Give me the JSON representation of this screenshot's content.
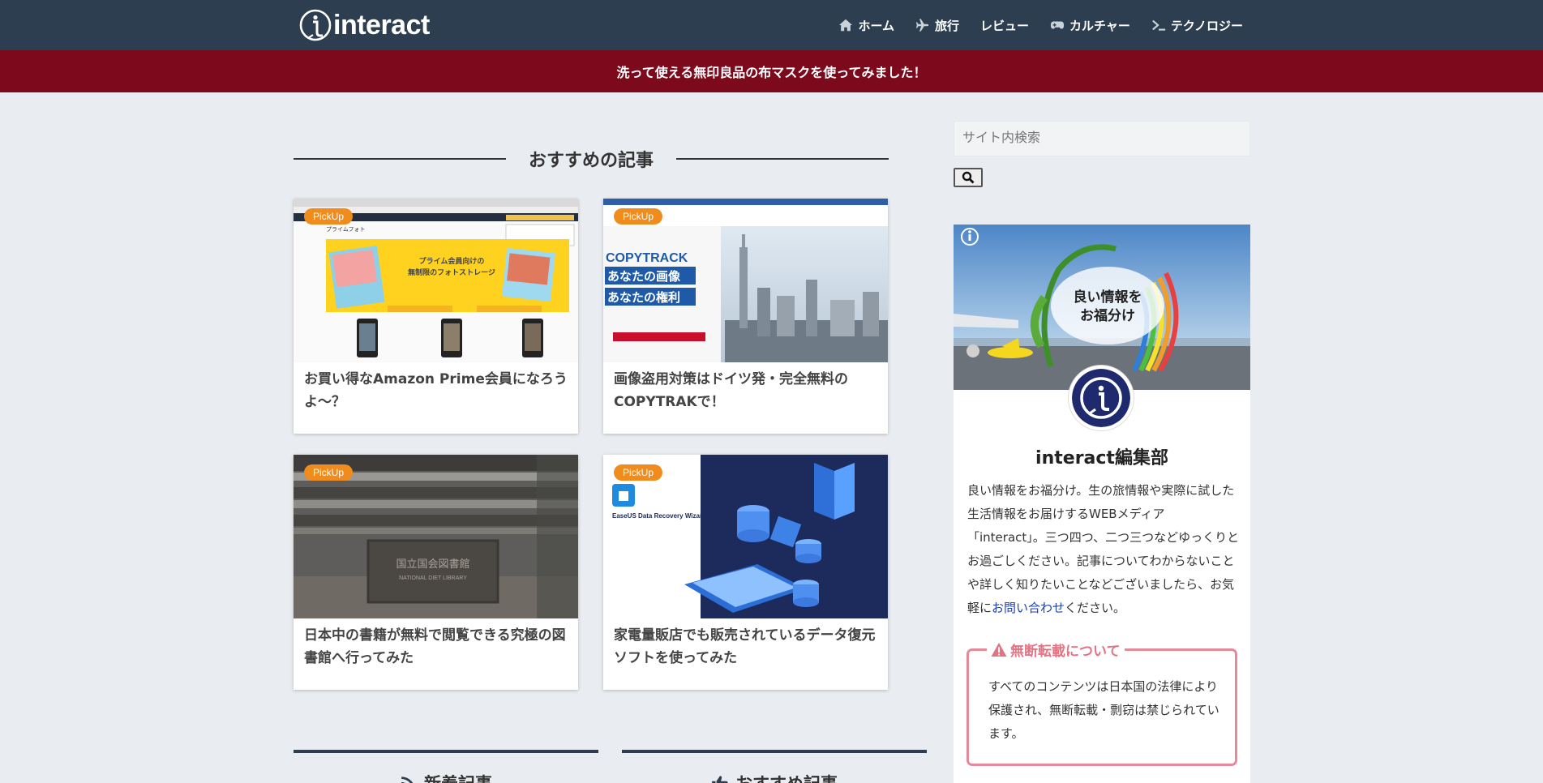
{
  "header": {
    "logo_text": "interact",
    "nav": [
      {
        "label": "ホーム",
        "icon": "home-icon"
      },
      {
        "label": "旅行",
        "icon": "plane-icon"
      },
      {
        "label": "レビュー",
        "icon": ""
      },
      {
        "label": "カルチャー",
        "icon": "gamepad-icon"
      },
      {
        "label": "テクノロジー",
        "icon": "terminal-icon"
      }
    ]
  },
  "banner": {
    "text": "洗って使える無印良品の布マスクを使ってみました！"
  },
  "main": {
    "section_title": "おすすめの記事",
    "badge": "PickUp",
    "cards": [
      {
        "title": "お買い得なAmazon Prime会員になろうよ〜？"
      },
      {
        "title": "画像盗用対策はドイツ発・完全無料のCOPYTRAKで！"
      },
      {
        "title": "日本中の書籍が無料で閲覧できる究極の図書館へ行ってみた"
      },
      {
        "title": "家電量販店でも販売されているデータ復元ソフトを使ってみた"
      }
    ],
    "thumbs": {
      "amazon_banner_title": "プライム会員向けの",
      "amazon_banner_sub": "無制限のフォトストレージ",
      "amazon_header": "プライムフォト",
      "copytrack_brand": "COPYTRACK",
      "copytrack_line1": "あなたの画像",
      "copytrack_line2": "あなたの権利",
      "library_sign": "国立国会図書館",
      "library_sign_en": "NATIONAL DIET LIBRARY",
      "easeus_label": "EaseUS Data Recovery Wizard"
    },
    "bottom_tabs": [
      {
        "label": "新着記事",
        "icon": "rss-icon"
      },
      {
        "label": "おすすめ記事",
        "icon": "thumbs-up-icon"
      }
    ]
  },
  "sidebar": {
    "search_placeholder": "サイト内検索",
    "cover_text_1": "良い情報を",
    "cover_text_2": "お福分け",
    "profile_name": "interact編集部",
    "profile_desc": "良い情報をお福分け。生の旅情報や実際に試した生活情報をお届けするWEBメディア「interact」。三つ四つ、二つ三つなどゆっくりとお過ごしください。記事についてわからないことや詳しく知りたいことなどございましたら、お気軽に",
    "profile_link": "お問い合わせ",
    "profile_desc_end": "ください。",
    "notice_title": "無断転載について",
    "notice_body": "すべてのコンテンツは日本国の法律により保護され、無断転載・剽窃は禁じられています。"
  },
  "colors": {
    "header_bg": "#2c3e50",
    "banner_bg": "#7c0a1c",
    "page_bg": "#e9ecf0",
    "badge": "#f08c1e",
    "notice_border": "#e68a9a",
    "link": "#1a3fb5"
  }
}
